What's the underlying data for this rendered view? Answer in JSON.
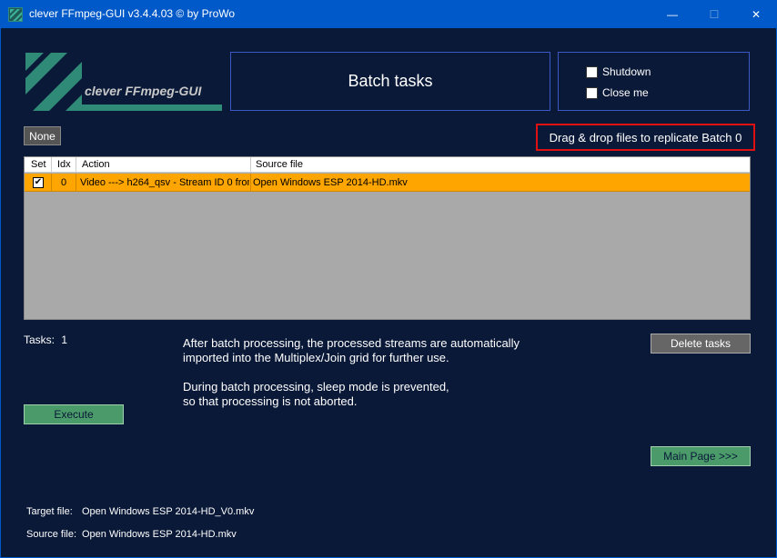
{
  "window": {
    "title": "clever FFmpeg-GUI v3.4.4.03   © by ProWo",
    "minimize": "—",
    "maximize": "☐",
    "close": "✕"
  },
  "logo": {
    "text": "clever FFmpeg-GUI"
  },
  "header": {
    "title": "Batch tasks"
  },
  "options": {
    "shutdown_label": "Shutdown",
    "close_me_label": "Close me"
  },
  "toolbar": {
    "none_label": "None",
    "dragdrop_label": "Drag & drop files to replicate Batch 0"
  },
  "grid": {
    "columns": [
      "Set",
      "Idx",
      "Action",
      "Source file"
    ],
    "rows": [
      {
        "set": "✔",
        "idx": "0",
        "action": "Video ---> h264_qsv - Stream ID 0 from",
        "source": "Open Windows ESP 2014-HD.mkv"
      }
    ]
  },
  "tasks": {
    "label": "Tasks:",
    "count": "1"
  },
  "info": {
    "line1": "After batch processing, the processed streams are automatically",
    "line2": "imported into the Multiplex/Join grid for further use.",
    "line3": "During batch processing, sleep mode is prevented,",
    "line4": "so that processing is not aborted."
  },
  "buttons": {
    "delete_tasks": "Delete tasks",
    "execute": "Execute",
    "main_page": "Main Page >>>"
  },
  "footer": {
    "target_label": "Target file:",
    "target_value": "Open Windows ESP 2014-HD_V0.mkv",
    "source_label": "Source file:",
    "source_value": "Open Windows ESP 2014-HD.mkv"
  },
  "colors": {
    "background": "#0a1938",
    "titlebar": "#0059c8",
    "row_highlight": "#ffa500",
    "accent_green": "#4a9a6a",
    "alert_red": "#e01010"
  }
}
